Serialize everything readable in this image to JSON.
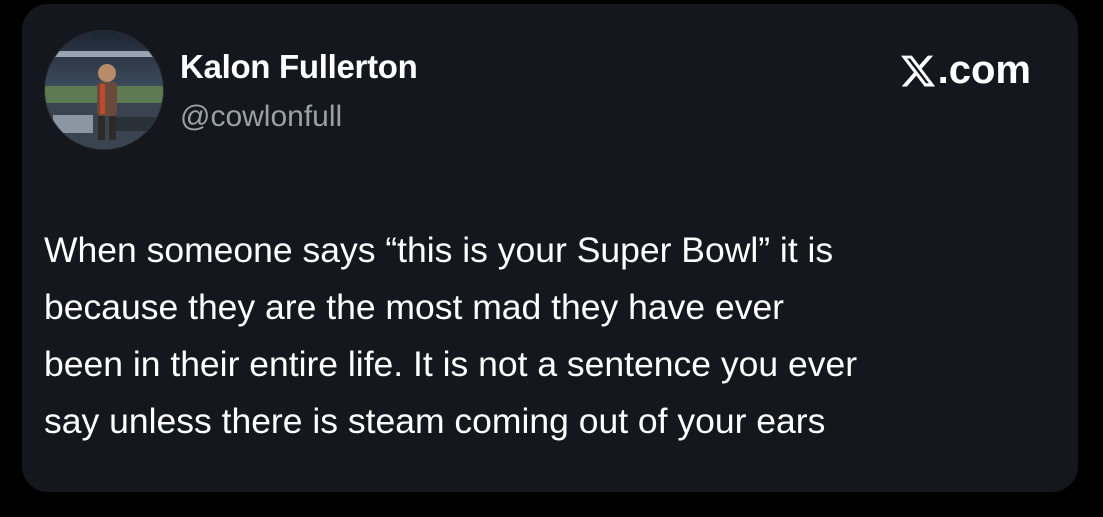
{
  "post": {
    "author": {
      "display_name": "Kalon Fullerton",
      "handle": "@cowlonfull",
      "avatar_icon": "profile-photo-stadium"
    },
    "brand": {
      "icon": "x-logo-icon",
      "label": ".com"
    },
    "text_lines": [
      "When someone says “this is your Super Bowl” it is",
      "because they are the most mad they have ever",
      "been in their entire life. It is not a sentence you ever",
      "say unless there is steam coming out of your ears"
    ]
  },
  "colors": {
    "page_background": "#000000",
    "card_background": "#15171e",
    "primary_text": "#ffffff",
    "secondary_text": "#9aa0a8"
  }
}
